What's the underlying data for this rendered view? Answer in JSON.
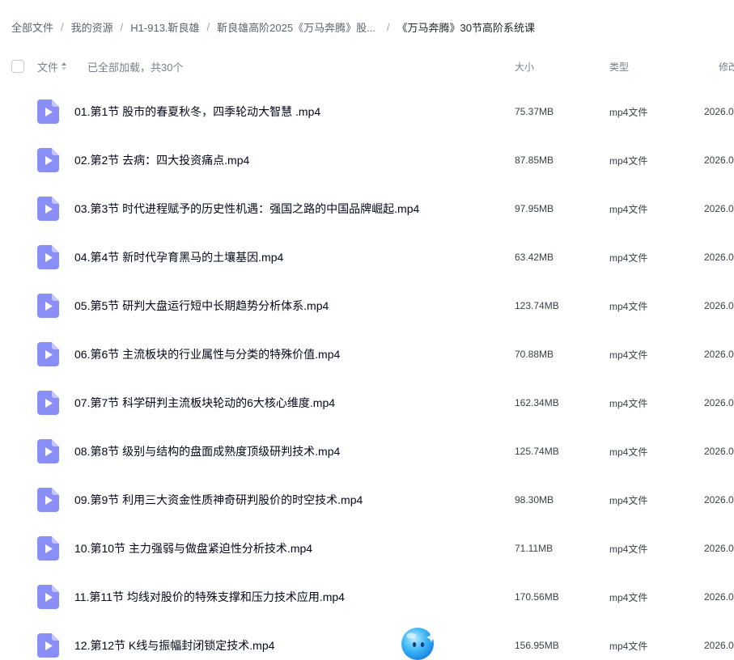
{
  "breadcrumb": {
    "items": [
      "全部文件",
      "我的资源",
      "H1-913.靳良雄",
      "靳良雄高阶2025《万马奔腾》股...",
      "《万马奔腾》30节高阶系统课"
    ],
    "separator": "/"
  },
  "header": {
    "file_label": "文件",
    "load_status": "已全部加载，共30个",
    "size_label": "大小",
    "type_label": "类型",
    "modified_label": "修改"
  },
  "files": [
    {
      "name": "01.第1节 股市的春夏秋冬，四季轮动大智慧 .mp4",
      "size": "75.37MB",
      "type": "mp4文件",
      "date": "2026.0"
    },
    {
      "name": "02.第2节 去病：四大投资痛点.mp4",
      "size": "87.85MB",
      "type": "mp4文件",
      "date": "2026.0"
    },
    {
      "name": "03.第3节 时代进程赋予的历史性机遇：强国之路的中国品牌崛起.mp4",
      "size": "97.95MB",
      "type": "mp4文件",
      "date": "2026.0"
    },
    {
      "name": "04.第4节 新时代孕育黑马的土壤基因.mp4",
      "size": "63.42MB",
      "type": "mp4文件",
      "date": "2026.0"
    },
    {
      "name": "05.第5节 研判大盘运行短中长期趋势分析体系.mp4",
      "size": "123.74MB",
      "type": "mp4文件",
      "date": "2026.0"
    },
    {
      "name": "06.第6节 主流板块的行业属性与分类的特殊价值.mp4",
      "size": "70.88MB",
      "type": "mp4文件",
      "date": "2026.0"
    },
    {
      "name": "07.第7节 科学研判主流板块轮动的6大核心维度.mp4",
      "size": "162.34MB",
      "type": "mp4文件",
      "date": "2026.0"
    },
    {
      "name": "08.第8节 级别与结构的盘面成熟度顶级研判技术.mp4",
      "size": "125.74MB",
      "type": "mp4文件",
      "date": "2026.0"
    },
    {
      "name": "09.第9节 利用三大资金性质神奇研判股价的时空技术.mp4",
      "size": "98.30MB",
      "type": "mp4文件",
      "date": "2026.0"
    },
    {
      "name": "10.第10节 主力强弱与做盘紧迫性分析技术.mp4",
      "size": "71.11MB",
      "type": "mp4文件",
      "date": "2026.0"
    },
    {
      "name": "11.第11节 均线对股价的特殊支撑和压力技术应用.mp4",
      "size": "170.56MB",
      "type": "mp4文件",
      "date": "2026.0"
    },
    {
      "name": "12.第12节 K线与振幅封闭锁定技术.mp4",
      "size": "156.95MB",
      "type": "mp4文件",
      "date": "2026.0"
    }
  ],
  "icons": {
    "file": "video-file-icon",
    "sort": "sort-icon",
    "assistant": "ai-assistant-icon"
  },
  "colors": {
    "video_icon": "#8a8ff8",
    "video_icon_fold": "#c4c7fd",
    "assistant": "#3fb8f7"
  }
}
